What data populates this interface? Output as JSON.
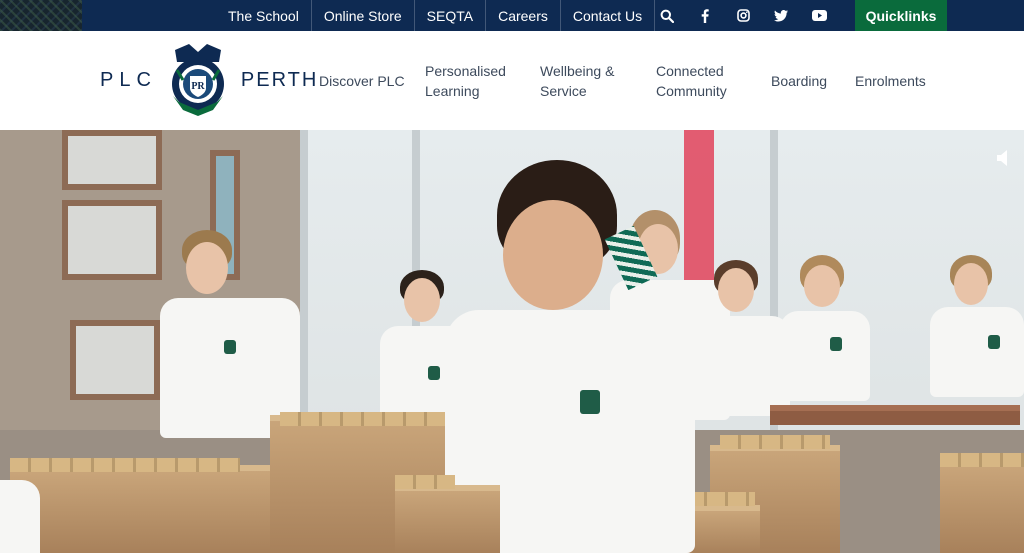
{
  "topbar": {
    "links": [
      "The School",
      "Online Store",
      "SEQTA",
      "Careers",
      "Contact Us"
    ],
    "socials": [
      "search-icon",
      "facebook-icon",
      "instagram-icon",
      "twitter-icon",
      "youtube-icon"
    ],
    "quicklinks_label": "Quicklinks",
    "colors": {
      "bar": "#0e2a52",
      "quicklinks": "#0a6b3c"
    }
  },
  "brand": {
    "left_word": "PLC",
    "right_word": "PERTH",
    "crest_icon": "school-crest-logo"
  },
  "nav": {
    "items": [
      "Discover PLC",
      "Personalised\nLearning",
      "Wellbeing &\nService",
      "Connected\nCommunity",
      "Boarding",
      "Enrolments"
    ]
  },
  "hero": {
    "description_icon": "hero-video",
    "sound_icon": "speaker-icon"
  }
}
